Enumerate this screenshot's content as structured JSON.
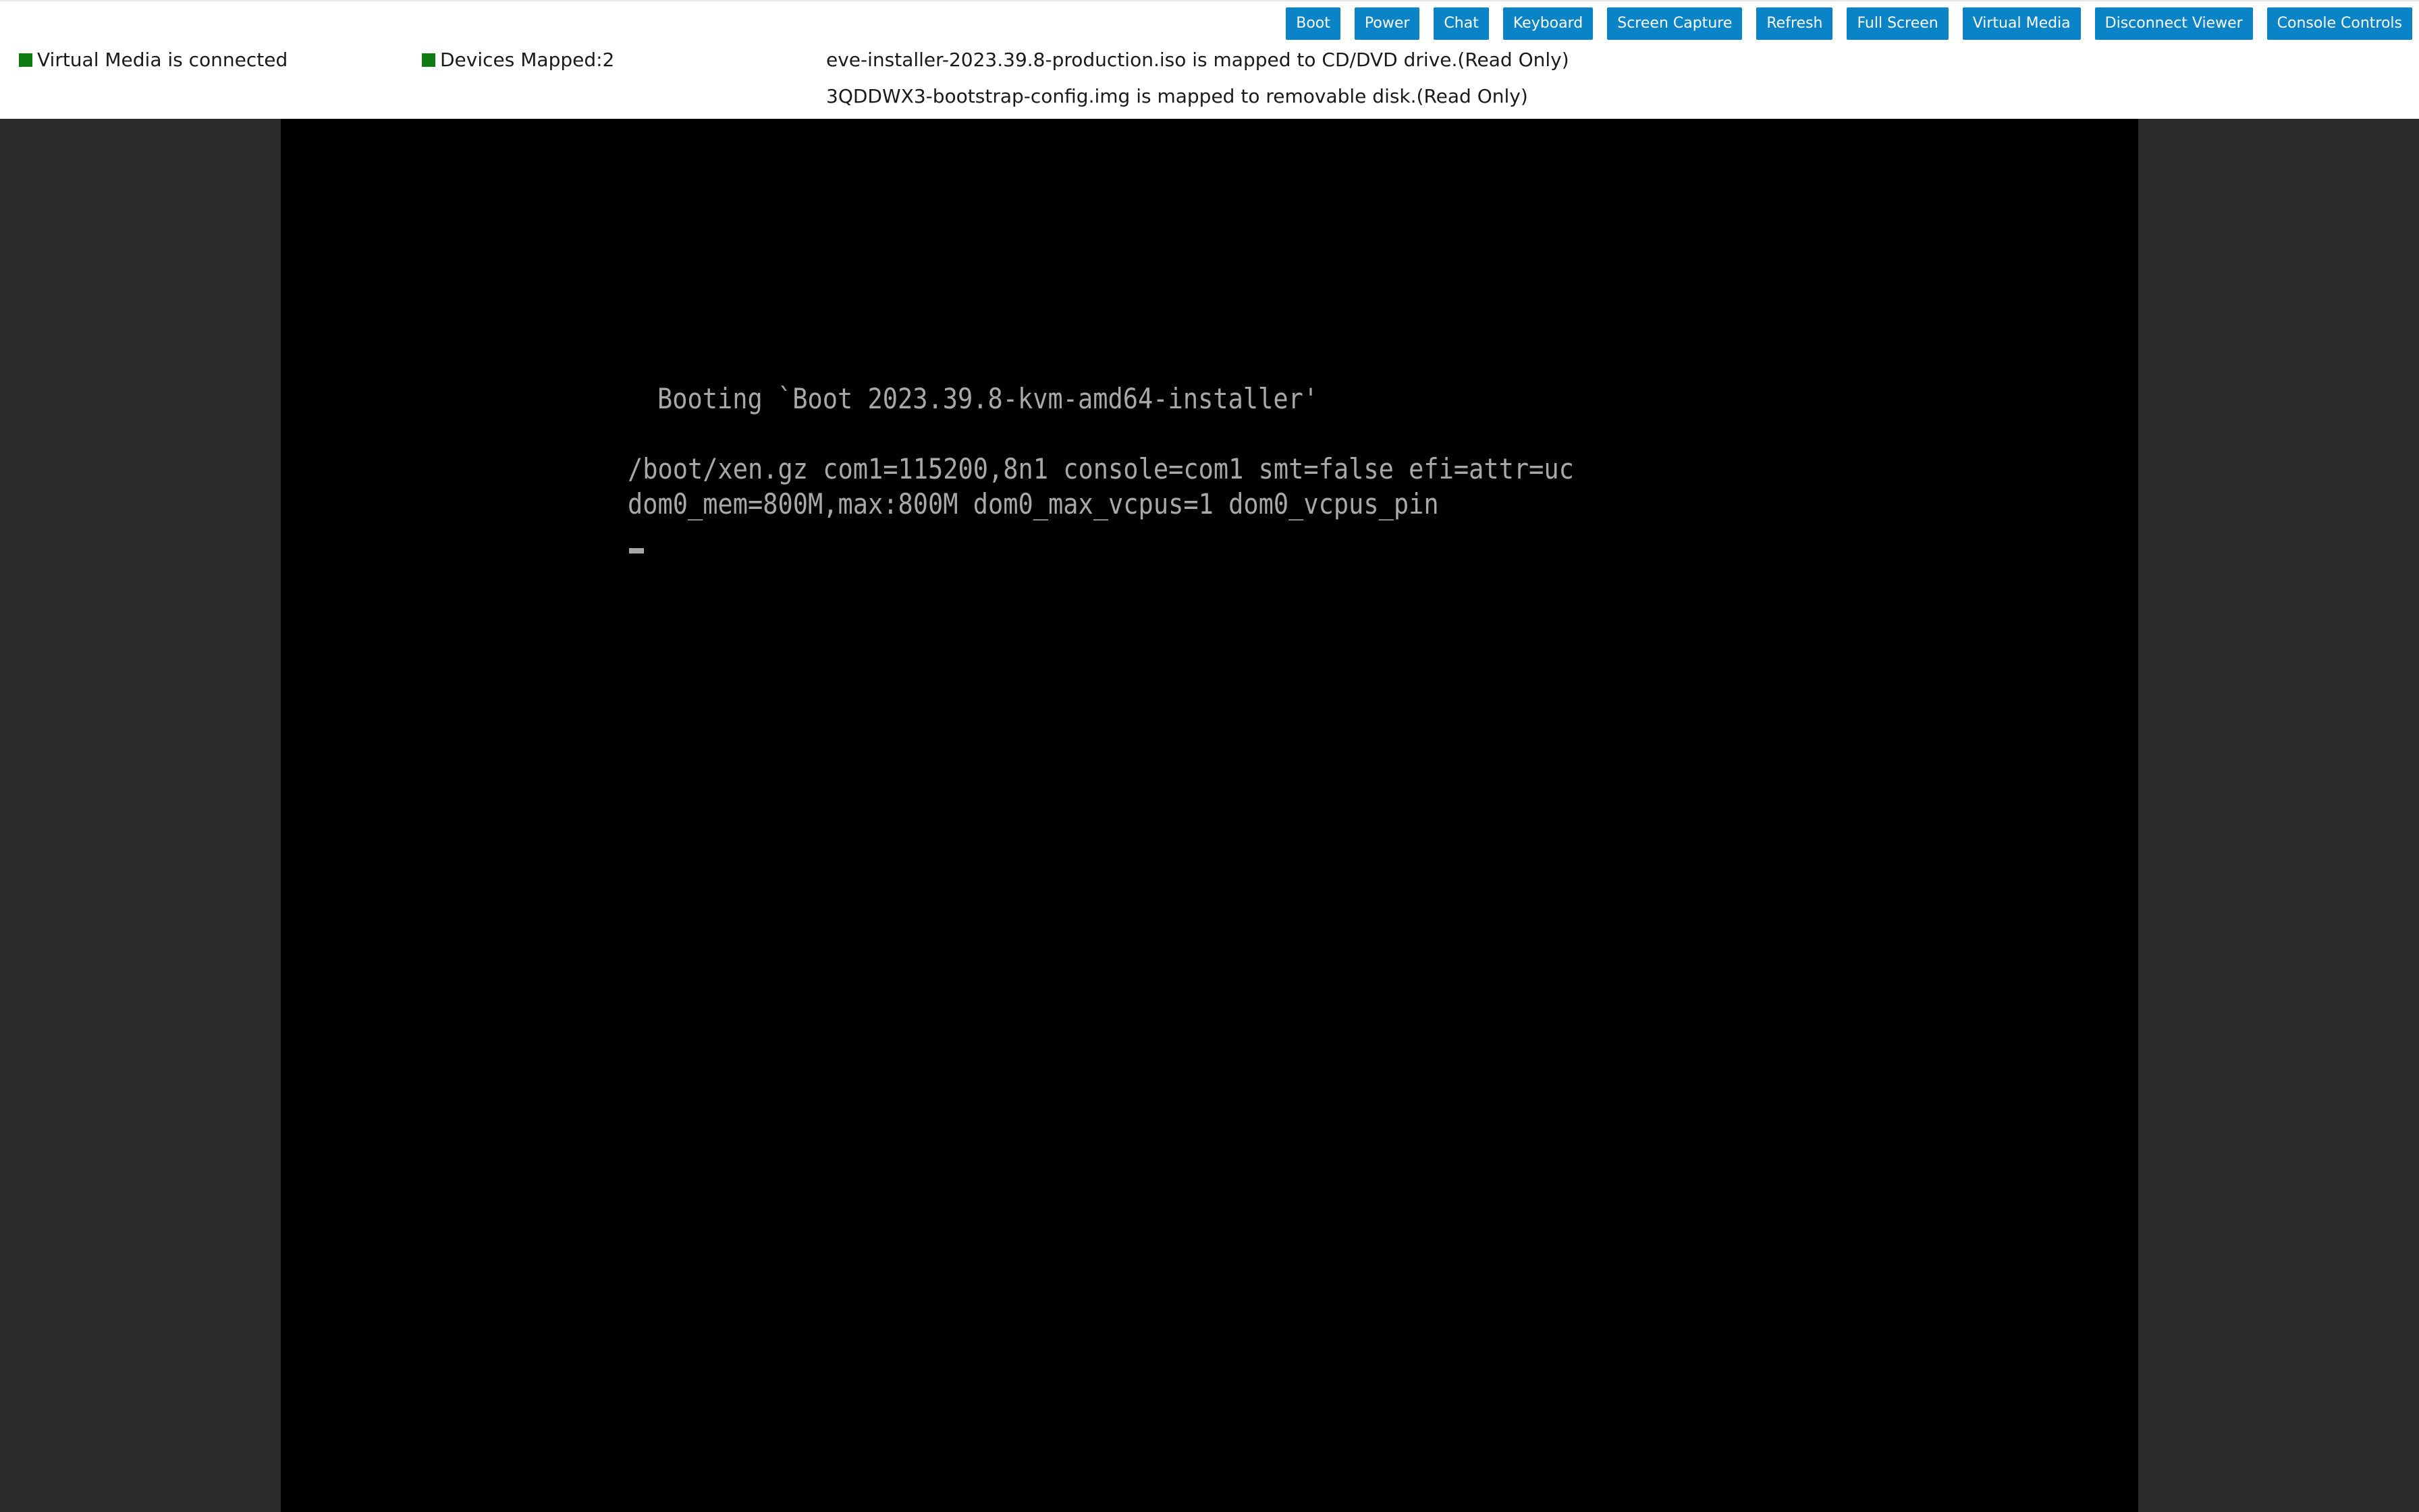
{
  "toolbar": {
    "buttons": [
      {
        "label": "Boot"
      },
      {
        "label": "Power"
      },
      {
        "label": "Chat"
      },
      {
        "label": "Keyboard"
      },
      {
        "label": "Screen Capture"
      },
      {
        "label": "Refresh"
      },
      {
        "label": "Full Screen"
      },
      {
        "label": "Virtual Media"
      },
      {
        "label": "Disconnect Viewer"
      },
      {
        "label": "Console Controls"
      }
    ]
  },
  "status": {
    "virtual_media": "Virtual Media is connected",
    "devices_mapped": "Devices Mapped:2",
    "indicator_color": "#0f7a0f"
  },
  "mappings": [
    "eve-installer-2023.39.8-production.iso is mapped to CD/DVD drive.(Read Only)",
    "3QDDWX3-bootstrap-config.img is mapped to removable disk.(Read Only)"
  ],
  "console": {
    "lines": [
      "Booting `Boot 2023.39.8-kvm-amd64-installer'",
      "/boot/xen.gz com1=115200,8n1 console=com1 smt=false efi=attr=uc",
      "dom0_mem=800M,max:800M dom0_max_vcpus=1 dom0_vcpus_pin"
    ]
  },
  "colors": {
    "button_bg": "#0a84c6",
    "console_bg": "#000000",
    "console_text": "#a8a8a8",
    "page_bg": "#2a2a2a"
  }
}
